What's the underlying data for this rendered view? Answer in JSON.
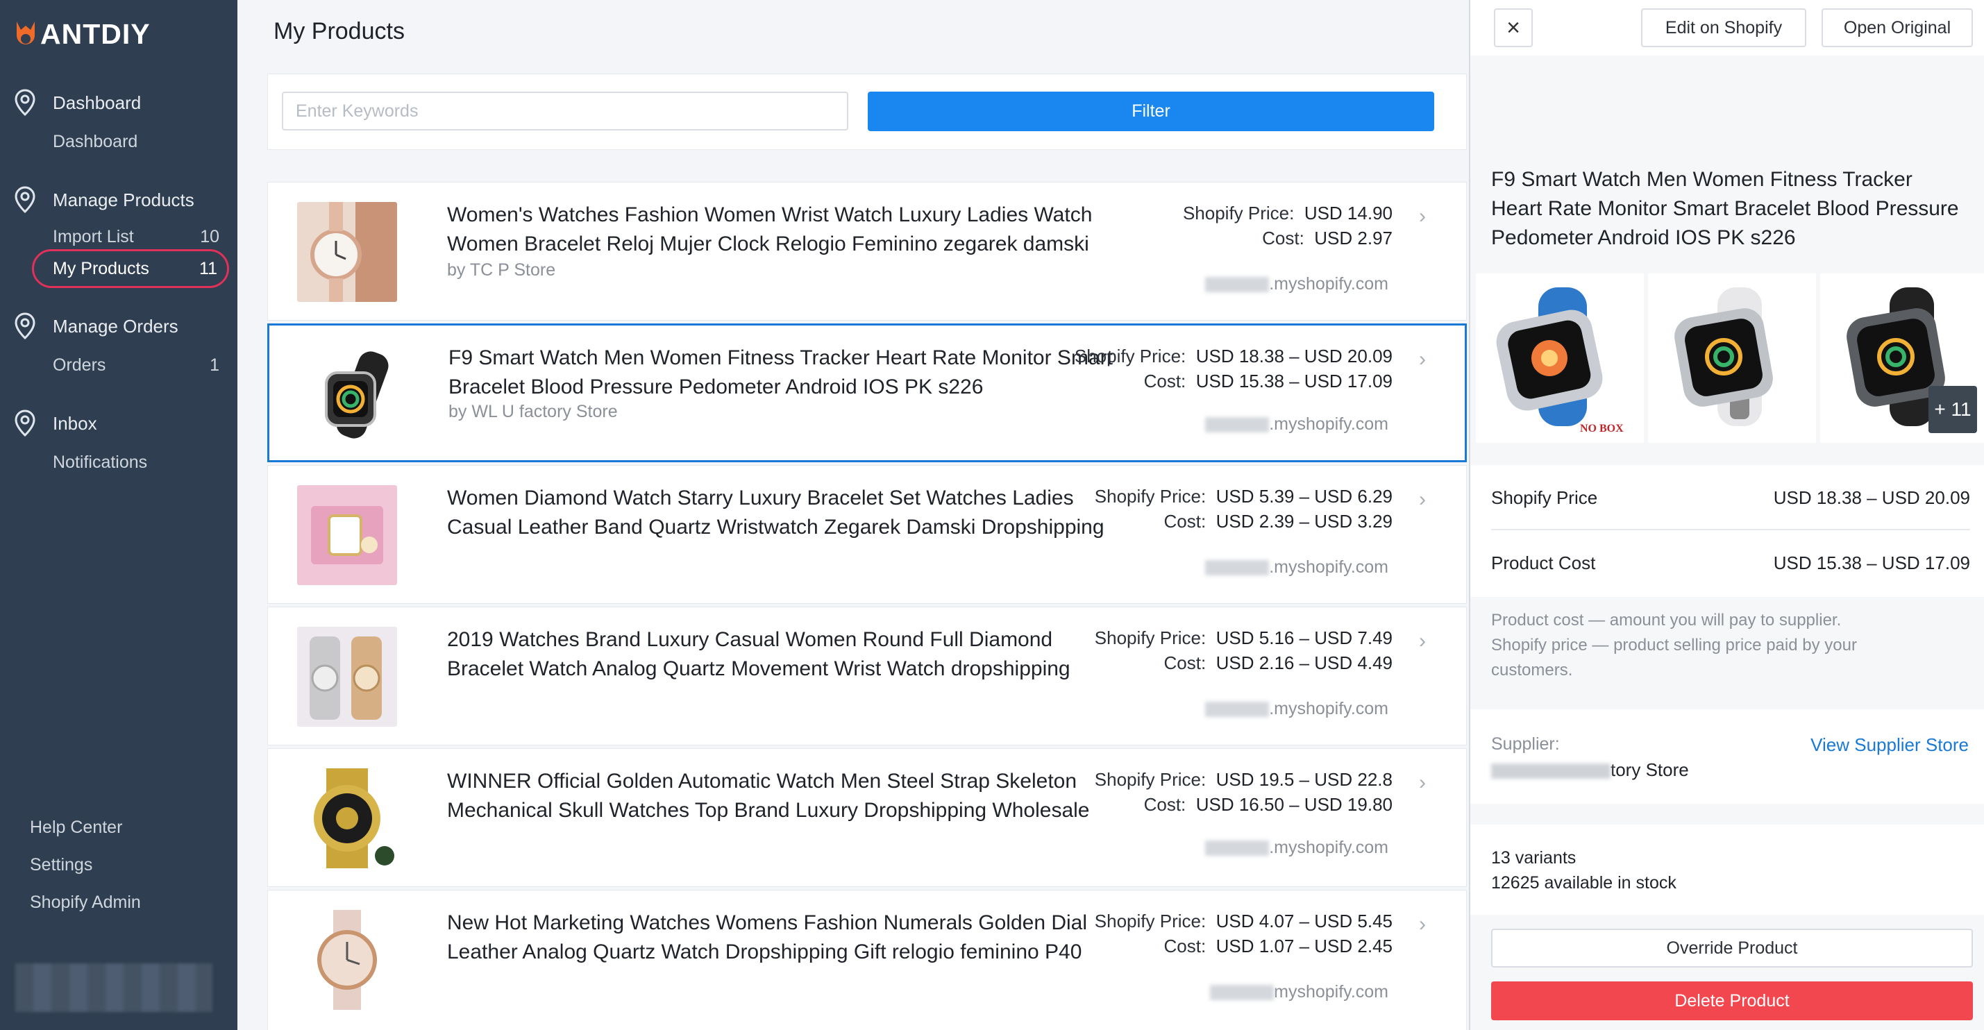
{
  "app": {
    "logo_text": "ANTDIY"
  },
  "sidebar": {
    "groups": [
      {
        "label": "Dashboard",
        "items": [
          {
            "label": "Dashboard",
            "count": ""
          }
        ]
      },
      {
        "label": "Manage Products",
        "items": [
          {
            "label": "Import List",
            "count": "10"
          },
          {
            "label": "My Products",
            "count": "11"
          }
        ]
      },
      {
        "label": "Manage Orders",
        "items": [
          {
            "label": "Orders",
            "count": "1"
          }
        ]
      },
      {
        "label": "Inbox",
        "items": [
          {
            "label": "Notifications",
            "count": ""
          }
        ]
      }
    ],
    "bottom_links": [
      "Help Center",
      "Settings",
      "Shopify Admin"
    ],
    "active_item": "My Products"
  },
  "main": {
    "title": "My Products",
    "search": {
      "placeholder": "Enter Keywords",
      "value": ""
    },
    "filter_label": "Filter",
    "price_label": "Shopify Price:",
    "cost_label": "Cost:",
    "products": [
      {
        "title": "Women's Watches Fashion Women Wrist Watch Luxury Ladies Watch Women Bracelet Reloj Mujer Clock Relogio Feminino zegarek damski",
        "store": "by TC        P Store",
        "shopify_price": "USD 14.90",
        "cost": "USD 2.97",
        "domain": ".myshopify.com"
      },
      {
        "title": "F9 Smart Watch Men Women Fitness Tracker Heart Rate Monitor Smart Bracelet Blood Pressure Pedometer Android IOS PK s226",
        "store": "by WL      U factory Store",
        "shopify_price": "USD 18.38 – USD 20.09",
        "cost": "USD 15.38 – USD 17.09",
        "domain": ".myshopify.com"
      },
      {
        "title": "Women Diamond Watch Starry Luxury Bracelet Set Watches Ladies Casual Leather Band Quartz Wristwatch Zegarek Damski Dropshipping",
        "store": "",
        "shopify_price": "USD 5.39 – USD 6.29",
        "cost": "USD 2.39 – USD 3.29",
        "domain": ".myshopify.com"
      },
      {
        "title": "2019 Watches Brand Luxury Casual Women Round Full Diamond Bracelet Watch Analog Quartz Movement Wrist Watch dropshipping",
        "store": "",
        "shopify_price": "USD 5.16 – USD 7.49",
        "cost": "USD 2.16 – USD 4.49",
        "domain": ".myshopify.com"
      },
      {
        "title": "WINNER Official Golden Automatic Watch Men Steel Strap Skeleton Mechanical Skull Watches Top Brand Luxury Dropshipping Wholesale",
        "store": "",
        "shopify_price": "USD 19.5 – USD 22.8",
        "cost": "USD 16.50 – USD 19.80",
        "domain": ".myshopify.com"
      },
      {
        "title": "New Hot Marketing Watches Womens Fashion Numerals Golden Dial Leather Analog Quartz Watch Dropshipping Gift relogio feminino P40",
        "store": "",
        "shopify_price": "USD 4.07 – USD 5.45",
        "cost": "USD 1.07 – USD 2.45",
        "domain": "myshopify.com"
      }
    ]
  },
  "panel": {
    "close_label": "×",
    "edit_label": "Edit on Shopify",
    "open_label": "Open Original",
    "title": "F9 Smart Watch Men Women Fitness Tracker Heart Rate Monitor Smart Bracelet Blood Pressure Pedometer Android IOS PK s226",
    "no_box_label": "NO BOX",
    "more_images": "+ 11",
    "shopify_price_label": "Shopify Price",
    "shopify_price": "USD 18.38 – USD 20.09",
    "cost_label": "Product Cost",
    "cost": "USD 15.38 – USD 17.09",
    "note_line1": "Product cost — amount you will pay to supplier.",
    "note_line2": "Shopify price — product selling price paid by your customers.",
    "supplier_label": "Supplier:",
    "supplier_link": "View Supplier Store",
    "supplier_name": "tory Store",
    "variants": "13 variants",
    "stock": "12625 available in stock",
    "override_label": "Override Product",
    "delete_label": "Delete Product"
  },
  "colors": {
    "sidebar_bg": "#2f3e50",
    "accent_blue": "#1a86f0",
    "danger": "#f2474e",
    "active_outline": "#e0315a"
  }
}
